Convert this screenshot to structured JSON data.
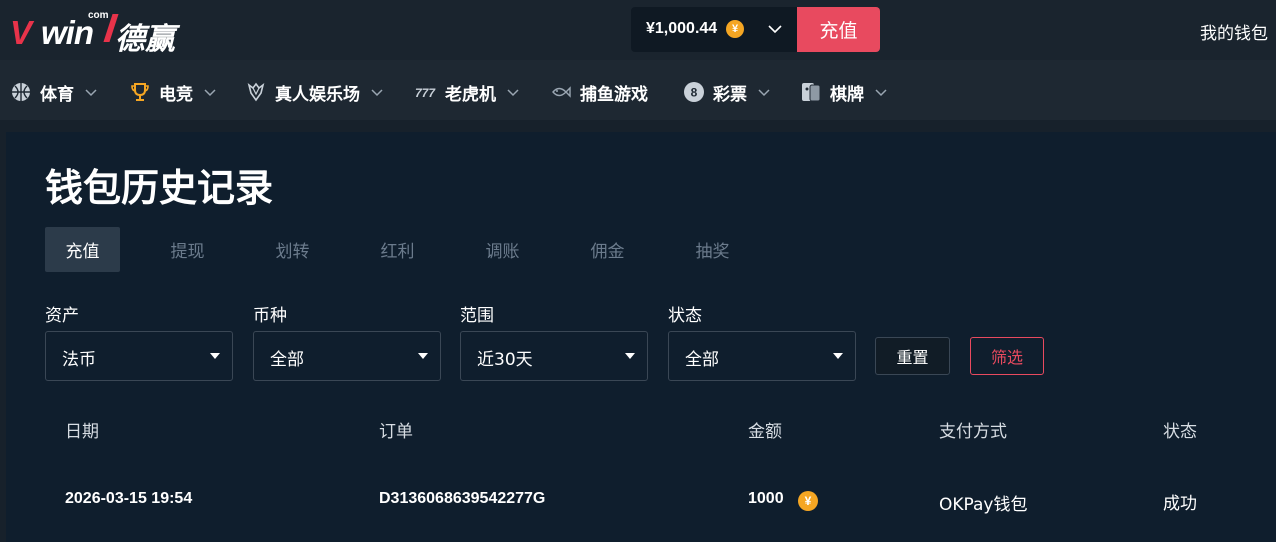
{
  "header": {
    "logo": {
      "brand": "Vwin",
      "suffix": "com",
      "cn_name": "德赢"
    },
    "balance": "¥1,000.44",
    "coin_symbol": "¥",
    "deposit_label": "充值",
    "wallet_label": "我的钱包"
  },
  "nav": {
    "items": [
      {
        "label": "体育",
        "icon": "sports-ball-icon",
        "has_dropdown": true
      },
      {
        "label": "电竞",
        "icon": "trophy-icon",
        "has_dropdown": true
      },
      {
        "label": "真人娱乐场",
        "icon": "diamond-icon",
        "has_dropdown": true
      },
      {
        "label": "老虎机",
        "icon": "slot-777-icon",
        "has_dropdown": true
      },
      {
        "label": "捕鱼游戏",
        "icon": "fish-icon",
        "has_dropdown": false
      },
      {
        "label": "彩票",
        "icon": "lottery-ball-icon",
        "has_dropdown": true
      },
      {
        "label": "棋牌",
        "icon": "cards-icon",
        "has_dropdown": true
      }
    ]
  },
  "page": {
    "title": "钱包历史记录",
    "tabs": [
      {
        "label": "充值",
        "active": true
      },
      {
        "label": "提现",
        "active": false
      },
      {
        "label": "划转",
        "active": false
      },
      {
        "label": "红利",
        "active": false
      },
      {
        "label": "调账",
        "active": false
      },
      {
        "label": "佣金",
        "active": false
      },
      {
        "label": "抽奖",
        "active": false
      }
    ],
    "filters": {
      "asset": {
        "label": "资产",
        "value": "法币"
      },
      "currency": {
        "label": "币种",
        "value": "全部"
      },
      "range": {
        "label": "范围",
        "value": "近30天"
      },
      "status": {
        "label": "状态",
        "value": "全部"
      },
      "reset_label": "重置",
      "filter_label": "筛选"
    },
    "table": {
      "columns": [
        "日期",
        "订单",
        "金额",
        "支付方式",
        "状态"
      ],
      "rows": [
        {
          "date": "2026-03-15 19:54",
          "order": "D3136068639542277G",
          "amount": "1000",
          "method": "OKPay钱包",
          "status": "成功"
        }
      ]
    }
  },
  "colors": {
    "accent": "#e84a5f",
    "coin": "#f5a623",
    "bg": "#17212b",
    "card": "#0f1e2d"
  }
}
